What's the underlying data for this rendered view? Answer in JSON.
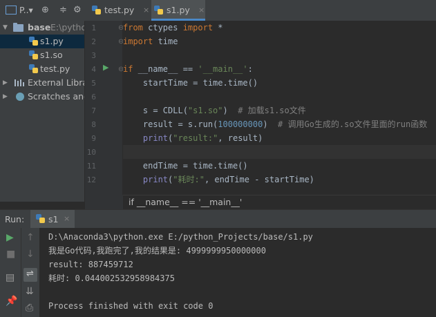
{
  "project_toolbar": {
    "title": "P..▾"
  },
  "tree": {
    "root": {
      "name": "base",
      "path": "E:\\pytho"
    },
    "files": [
      "s1.py",
      "s1.so",
      "test.py"
    ],
    "external": "External Librar",
    "scratches": "Scratches and"
  },
  "tabs": [
    {
      "label": "test.py",
      "close": "×"
    },
    {
      "label": "s1.py",
      "close": "×"
    }
  ],
  "line_numbers": [
    "1",
    "2",
    "3",
    "4",
    "5",
    "6",
    "7",
    "8",
    "9",
    "10",
    "11",
    "12"
  ],
  "code": {
    "l1": {
      "kw1": "from",
      "mod": " ctypes ",
      "kw2": "import",
      "rest": " *"
    },
    "l2": {
      "kw": "import",
      "rest": " time"
    },
    "l4": {
      "kw": "if",
      "a": " __name__ == ",
      "s": "'__main__'",
      "b": ":"
    },
    "l5": "    startTime = time.time()",
    "l7": {
      "a": "    s = CDLL(",
      "s": "\"s1.so\"",
      "b": ")  ",
      "c": "# 加载s1.so文件"
    },
    "l8": {
      "a": "    result = s.run(",
      "n": "100000000",
      "b": ")  ",
      "c": "# 调用Go生成的.so文件里面的run函数"
    },
    "l9": {
      "f": "    print",
      "a": "(",
      "s": "\"result:\"",
      "b": ", result)"
    },
    "l11": "    endTime = time.time()",
    "l12": {
      "f": "    print",
      "a": "(",
      "s": "\"耗时:\"",
      "b": ", endTime - startTime)"
    }
  },
  "breadcrumb": "if __name__ == '__main__'",
  "run": {
    "label": "Run:",
    "tab": "s1",
    "output": [
      "D:\\Anaconda3\\python.exe E:/python_Projects/base/s1.py",
      "我是Go代码,我跑完了,我的结果是: 4999999950000000",
      "result: 887459712",
      "耗时: 0.044002532958984375",
      "",
      "Process finished with exit code 0"
    ]
  },
  "colors": {
    "keyword": "#cc7832",
    "string": "#6a8759",
    "number": "#6897bb",
    "comment": "#808080",
    "selection": "#0d293e"
  }
}
